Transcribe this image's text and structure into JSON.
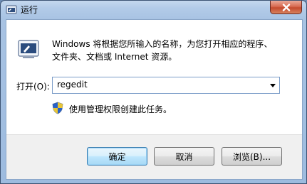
{
  "window": {
    "title": "运行"
  },
  "icons": {
    "title": "run-icon",
    "dialog": "run-icon",
    "close": "close-icon",
    "dropdown": "chevron-down-icon",
    "admin": "uac-shield-icon"
  },
  "dialog": {
    "description_line1": "Windows 将根据您所输入的名称，为您打开相应的程序、",
    "description_line2": "文件夹、文档或 Internet 资源。",
    "open_label": "打开(O):",
    "open_value": "regedit",
    "admin_note": "使用管理权限创建此任务。"
  },
  "buttons": {
    "ok": "确定",
    "cancel": "取消",
    "browse": "浏览(B)..."
  },
  "colors": {
    "accent": "#3c7fb1",
    "close": "#c44a2e",
    "frame": "#b3cbe8"
  }
}
